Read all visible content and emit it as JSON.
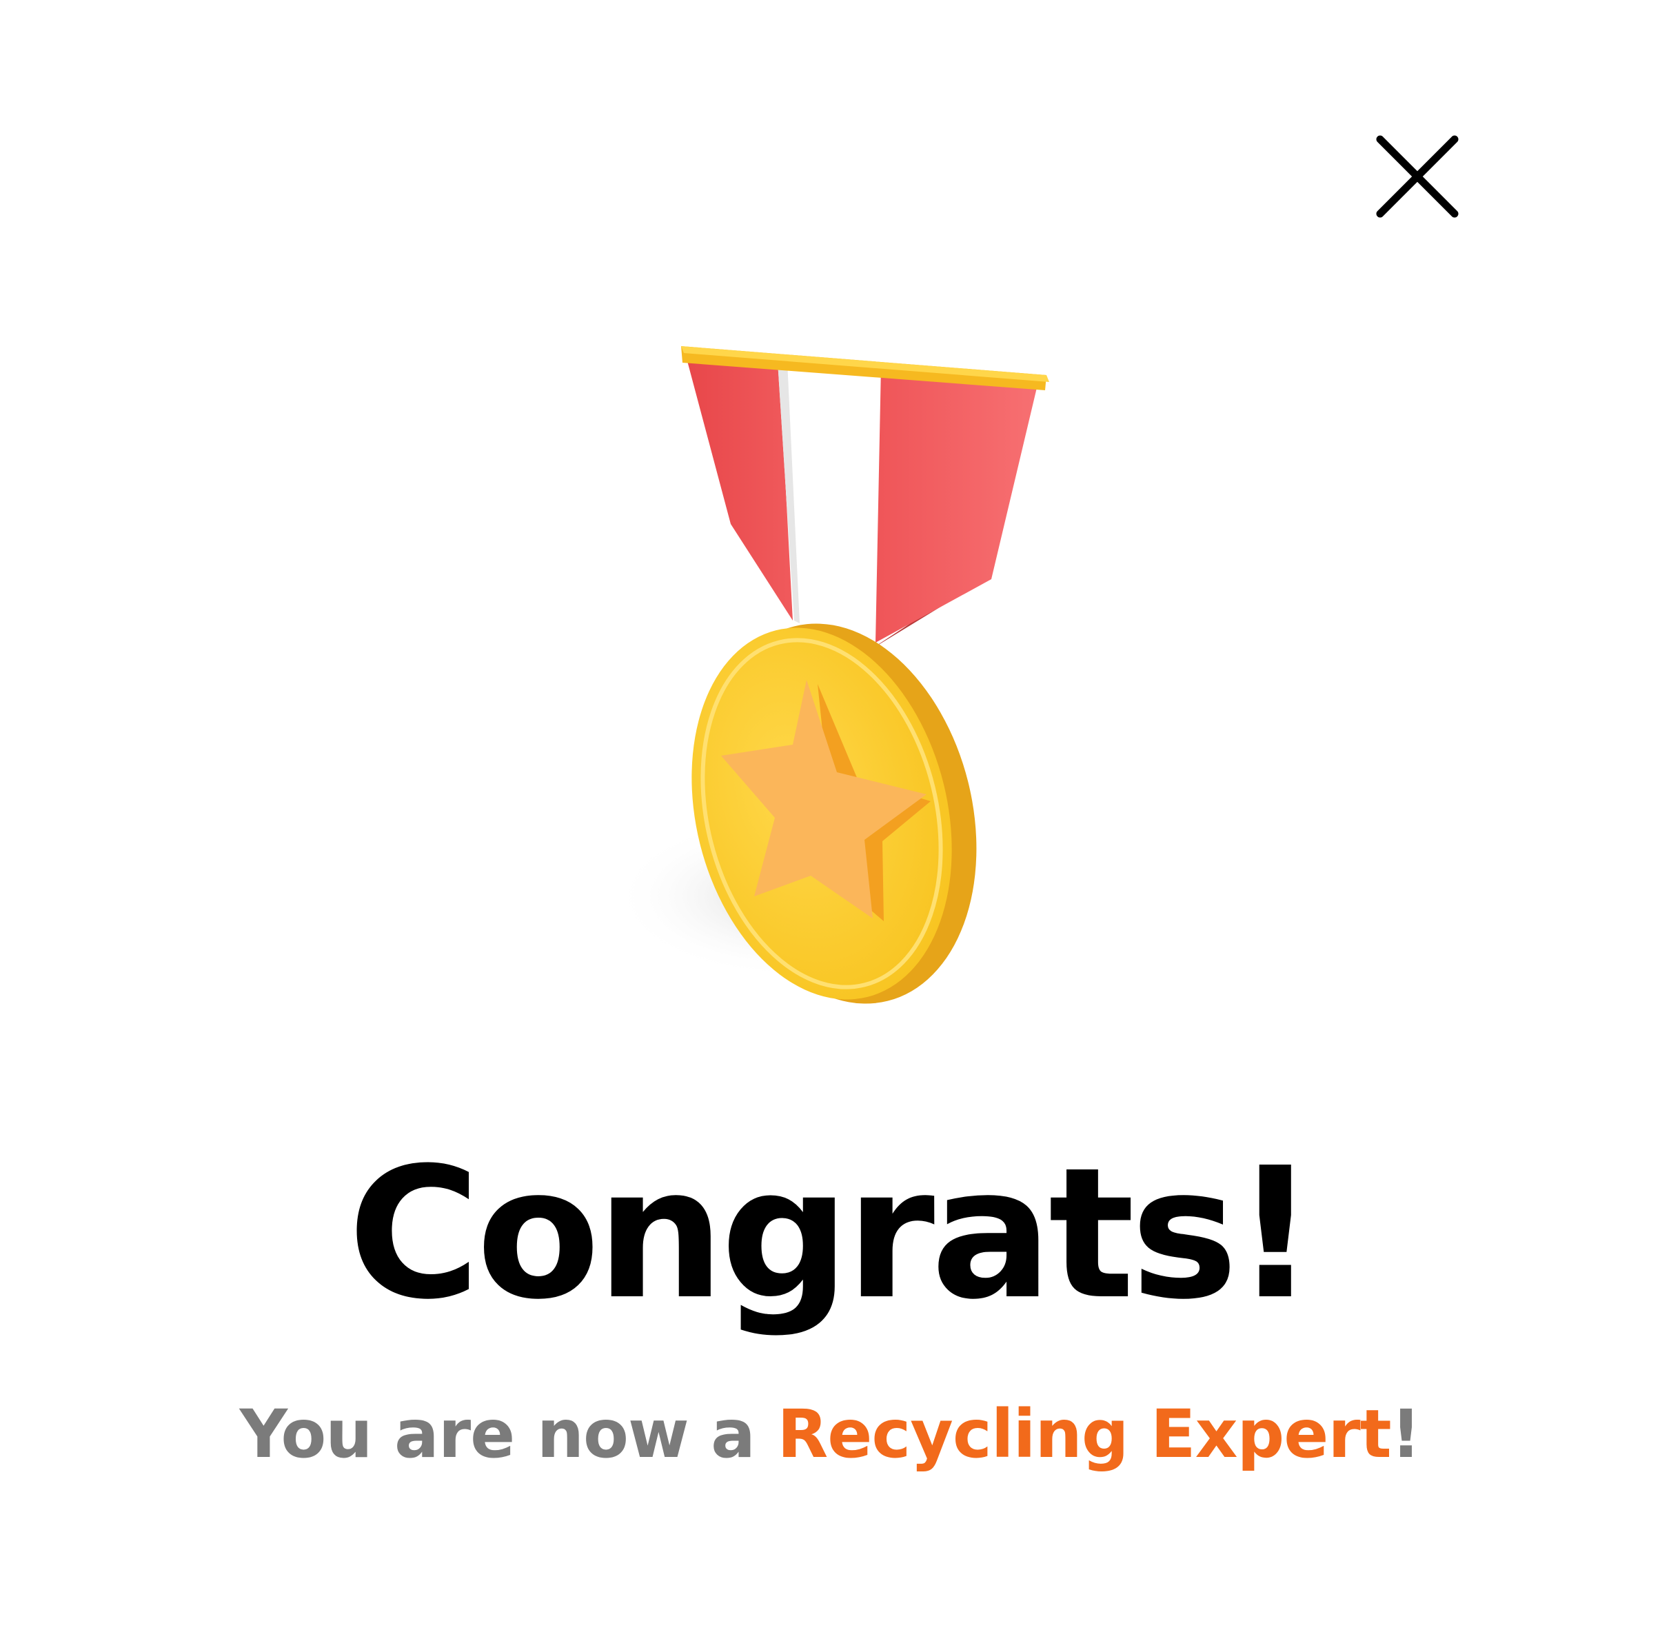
{
  "dialog": {
    "close_label": "",
    "title": "Congrats!",
    "message": {
      "prefix": "You are now a ",
      "highlight": "Recycling Expert",
      "suffix": "!"
    },
    "medal_icon": "medal-star-icon",
    "close_icon": "close-icon"
  },
  "colors": {
    "highlight": "#f26a1b",
    "subtitle_gray": "#7b7b7b",
    "title": "#000000"
  }
}
